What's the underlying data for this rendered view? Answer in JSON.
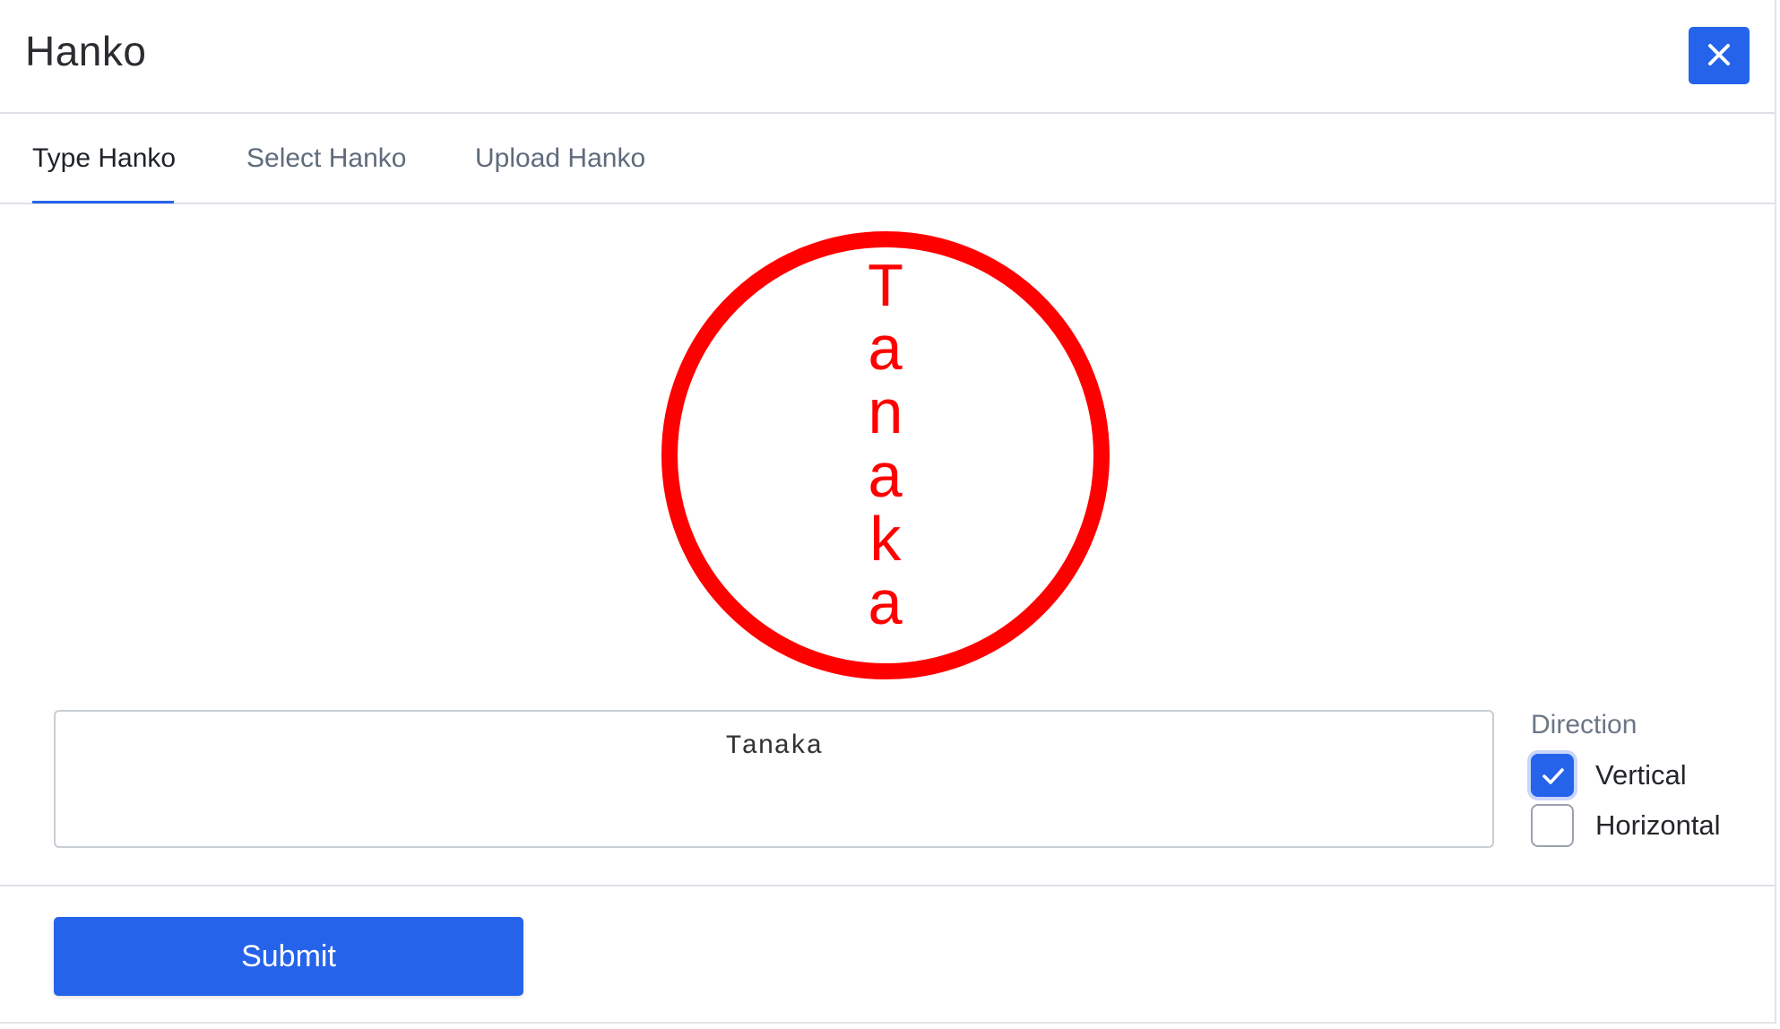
{
  "dialog": {
    "title": "Hanko",
    "close_icon": "close-icon"
  },
  "tabs": [
    {
      "label": "Type Hanko",
      "active": true
    },
    {
      "label": "Select Hanko",
      "active": false
    },
    {
      "label": "Upload Hanko",
      "active": false
    }
  ],
  "stamp": {
    "text": "Tanaka",
    "letters": [
      "T",
      "a",
      "n",
      "a",
      "k",
      "a"
    ],
    "color": "#ff0000",
    "direction": "vertical"
  },
  "input": {
    "value": "Tanaka"
  },
  "direction": {
    "label": "Direction",
    "options": [
      {
        "label": "Vertical",
        "checked": true,
        "icon": "check-icon"
      },
      {
        "label": "Horizontal",
        "checked": false
      }
    ]
  },
  "footer": {
    "submit_label": "Submit"
  },
  "colors": {
    "accent": "#2563eb",
    "stamp": "#ff0000",
    "border": "#dde1e6"
  }
}
